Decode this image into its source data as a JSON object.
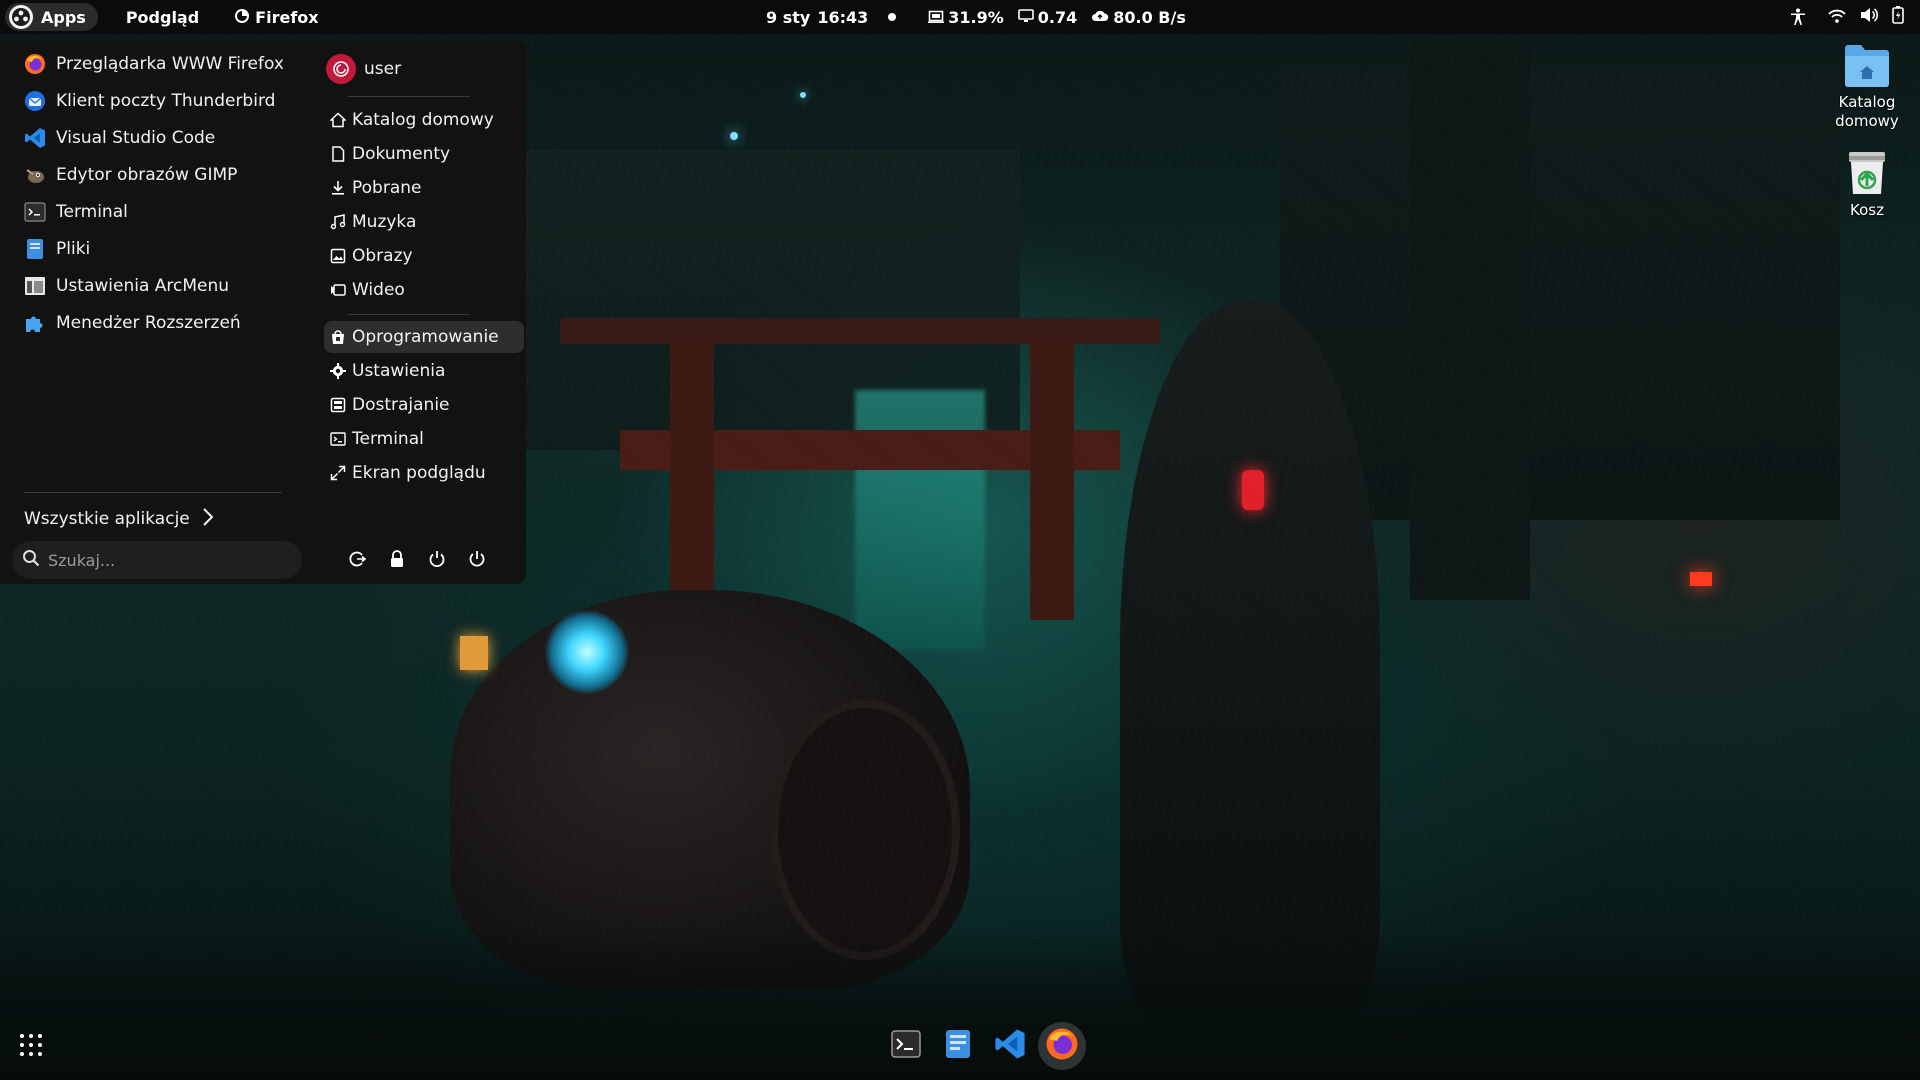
{
  "topbar": {
    "apps_label": "Apps",
    "preview_label": "Podgląd",
    "firefox_label": "Firefox",
    "date": "9 sty",
    "time": "16:43",
    "battery": "31.9%",
    "load": "0.74",
    "network": "80.0 B/s"
  },
  "menu": {
    "apps": [
      {
        "label": "Przeglądarka WWW Firefox",
        "icon": "firefox-icon"
      },
      {
        "label": "Klient poczty Thunderbird",
        "icon": "thunderbird-icon"
      },
      {
        "label": "Visual Studio Code",
        "icon": "vscode-icon"
      },
      {
        "label": "Edytor obrazów GIMP",
        "icon": "gimp-icon"
      },
      {
        "label": "Terminal",
        "icon": "terminal-icon"
      },
      {
        "label": "Pliki",
        "icon": "files-icon"
      },
      {
        "label": "Ustawienia ArcMenu",
        "icon": "arcmenu-settings-icon"
      },
      {
        "label": "Menedżer Rozszerzeń",
        "icon": "extensions-icon"
      }
    ],
    "all_apps_label": "Wszystkie aplikacje",
    "search_placeholder": "Szukaj...",
    "user_name": "user",
    "places": [
      {
        "label": "Katalog domowy",
        "icon": "home-icon"
      },
      {
        "label": "Dokumenty",
        "icon": "document-icon"
      },
      {
        "label": "Pobrane",
        "icon": "download-icon"
      },
      {
        "label": "Muzyka",
        "icon": "music-icon"
      },
      {
        "label": "Obrazy",
        "icon": "image-icon"
      },
      {
        "label": "Wideo",
        "icon": "video-icon"
      }
    ],
    "shortcuts": [
      {
        "label": "Oprogramowanie",
        "icon": "software-icon",
        "active": true
      },
      {
        "label": "Ustawienia",
        "icon": "gear-icon"
      },
      {
        "label": "Dostrajanie",
        "icon": "tweaks-icon"
      },
      {
        "label": "Terminal",
        "icon": "terminal-icon"
      },
      {
        "label": "Ekran podglądu",
        "icon": "expand-icon"
      }
    ]
  },
  "desktop": {
    "home_label": "Katalog domowy",
    "trash_label": "Kosz"
  },
  "colors": {
    "accent_active": "#2e2e30",
    "avatar": "#c2183a",
    "menu_bg": "#121212",
    "topbar_bg": "#0b0b0c"
  }
}
